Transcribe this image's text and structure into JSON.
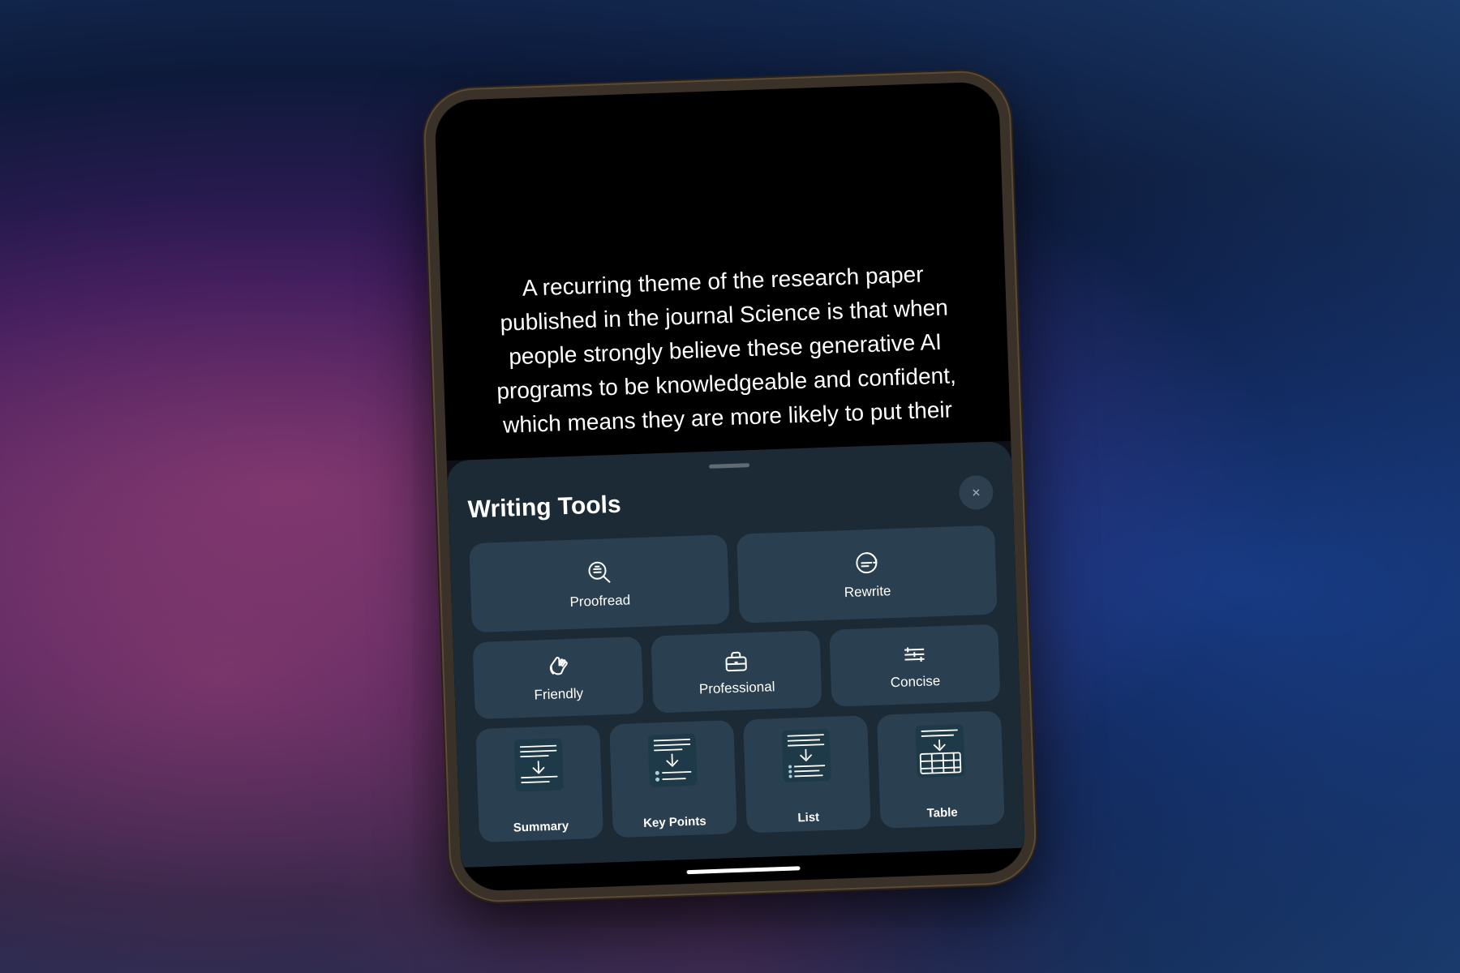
{
  "background": {
    "color1": "#6b2d6b",
    "color2": "#0d1a3a"
  },
  "article": {
    "text": "A recurring theme of the research paper published in the journal Science is that when people strongly believe these generative AI programs to be knowledgeable and confident, which means they are more likely to put their"
  },
  "panel": {
    "title": "Writing Tools",
    "close_label": "×",
    "drag_handle_label": ""
  },
  "tools": {
    "row1": [
      {
        "id": "proofread",
        "label": "Proofread",
        "icon": "magnify-search"
      },
      {
        "id": "rewrite",
        "label": "Rewrite",
        "icon": "refresh-circle"
      }
    ],
    "row2": [
      {
        "id": "friendly",
        "label": "Friendly",
        "icon": "wave-hand"
      },
      {
        "id": "professional",
        "label": "Professional",
        "icon": "briefcase"
      },
      {
        "id": "concise",
        "label": "Concise",
        "icon": "adjust-lines"
      }
    ],
    "row3": [
      {
        "id": "summary",
        "label": "Summary",
        "icon": "summary-lines"
      },
      {
        "id": "key-points",
        "label": "Key Points",
        "icon": "key-points-lines"
      },
      {
        "id": "list",
        "label": "List",
        "icon": "list-lines"
      },
      {
        "id": "table",
        "label": "Table",
        "icon": "table-grid"
      }
    ]
  },
  "home_indicator": {
    "visible": true
  }
}
